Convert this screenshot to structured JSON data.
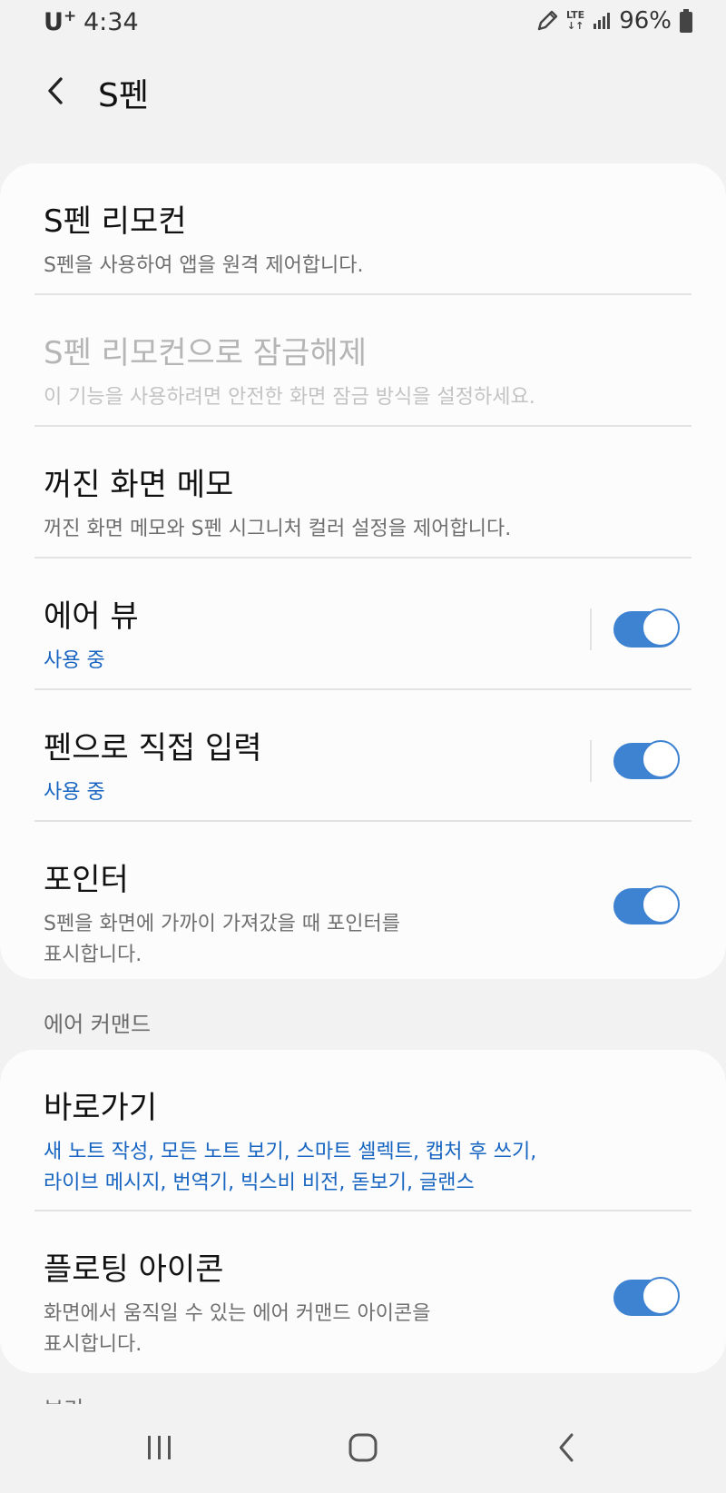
{
  "status_bar": {
    "carrier": "U",
    "carrier_plus": "+",
    "time": "4:34",
    "network": "LTE",
    "battery": "96%"
  },
  "header": {
    "title": "S펜"
  },
  "card1": {
    "items": [
      {
        "title": "S펜 리모컨",
        "subtitle": "S펜을 사용하여 앱을 원격 제어합니다."
      },
      {
        "title": "S펜 리모컨으로 잠금해제",
        "subtitle": "이 기능을 사용하려면 안전한 화면 잠금 방식을 설정하세요."
      },
      {
        "title": "꺼진 화면 메모",
        "subtitle": "꺼진 화면 메모와 S펜 시그니처 컬러 설정을 제어합니다."
      },
      {
        "title": "에어 뷰",
        "subtitle": "사용 중",
        "toggle": true
      },
      {
        "title": "펜으로 직접 입력",
        "subtitle": "사용 중",
        "toggle": true
      },
      {
        "title": "포인터",
        "subtitle_line1": "S펜을 화면에 가까이 가져갔을 때 포인터를",
        "subtitle_line2": "표시합니다.",
        "toggle": true
      }
    ]
  },
  "section_air_command": "에어 커맨드",
  "card2": {
    "items": [
      {
        "title": "바로가기",
        "subtitle_line1": "새 노트 작성, 모든 노트 보기, 스마트 셀렉트, 캡처 후 쓰기,",
        "subtitle_line2": "라이브 메시지, 번역기, 빅스비 비전, 돋보기, 글랜스"
      },
      {
        "title": "플로팅 아이콘",
        "subtitle_line1": "화면에서 움직일 수 있는 에어 커맨드 아이콘을",
        "subtitle_line2": "표시합니다.",
        "toggle": true
      }
    ]
  },
  "section_partial": "보기",
  "colors": {
    "accent": "#3e82d2",
    "link_blue": "#1765c1",
    "background": "#f2f2f2",
    "card": "#fcfcfc"
  },
  "icons": {
    "status": [
      "pen-icon",
      "lte-icon",
      "signal-icon",
      "battery-icon"
    ],
    "nav": [
      "recent-apps-icon",
      "home-icon",
      "back-icon"
    ]
  }
}
